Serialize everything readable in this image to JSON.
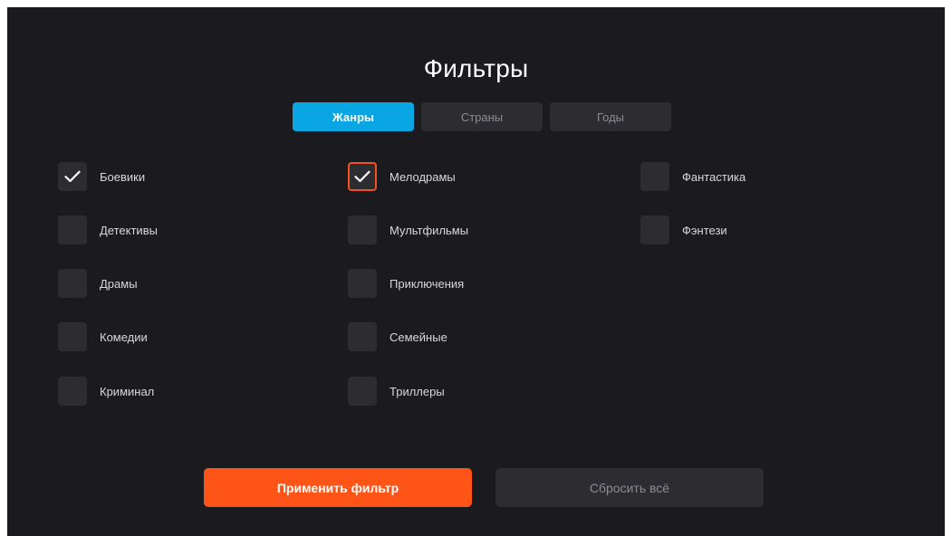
{
  "title": "Фильтры",
  "tabs": [
    {
      "label": "Жанры",
      "active": true
    },
    {
      "label": "Страны",
      "active": false
    },
    {
      "label": "Годы",
      "active": false
    }
  ],
  "genres": {
    "col1": [
      {
        "label": "Боевики",
        "checked": true
      },
      {
        "label": "Детективы",
        "checked": false
      },
      {
        "label": "Драмы",
        "checked": false
      },
      {
        "label": "Комедии",
        "checked": false
      },
      {
        "label": "Криминал",
        "checked": false
      }
    ],
    "col2": [
      {
        "label": "Мелодрамы",
        "checked": true,
        "focused": true
      },
      {
        "label": "Мультфильмы",
        "checked": false
      },
      {
        "label": "Приключения",
        "checked": false
      },
      {
        "label": "Семейные",
        "checked": false
      },
      {
        "label": "Триллеры",
        "checked": false
      }
    ],
    "col3": [
      {
        "label": "Фантастика",
        "checked": false
      },
      {
        "label": "Фэнтези",
        "checked": false
      }
    ]
  },
  "buttons": {
    "apply_label": "Применить фильтр",
    "reset_label": "Сбросить всё"
  },
  "colors": {
    "background": "#1b1b1f",
    "accent_blue": "#0aa6e4",
    "accent_orange": "#fe5418",
    "control_bg": "#2c2c31"
  },
  "icons": {
    "checkmark": "check-icon"
  }
}
